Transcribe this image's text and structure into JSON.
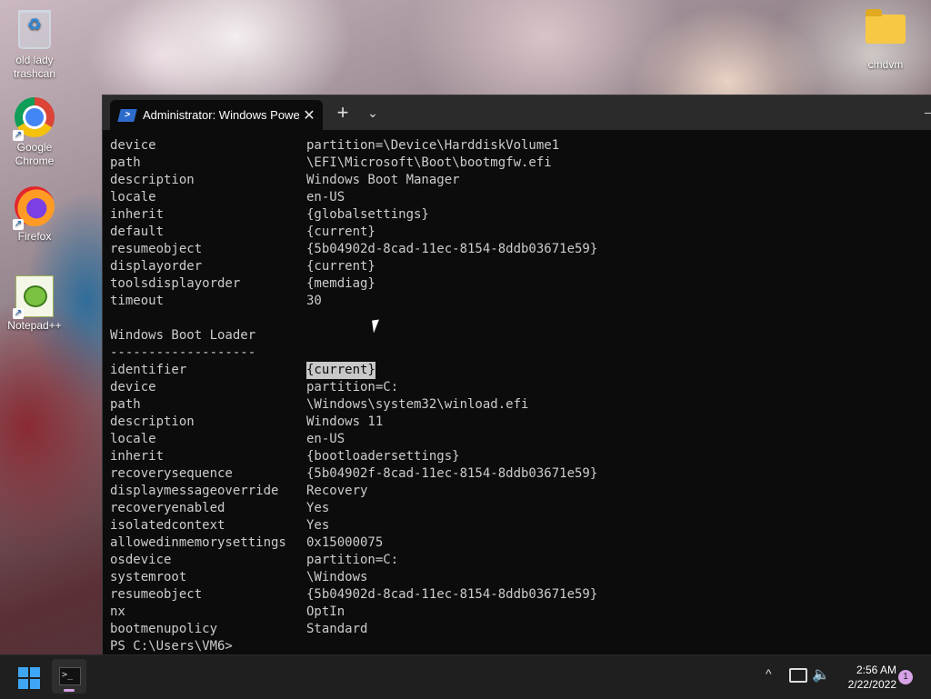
{
  "desktop": {
    "icons": [
      {
        "label": "old lady\ntrashcan"
      },
      {
        "label": "Google\nChrome"
      },
      {
        "label": "Firefox"
      },
      {
        "label": "Notepad++"
      },
      {
        "label": "cmdvm"
      }
    ]
  },
  "terminal": {
    "tab_title": "Administrator: Windows PowerS",
    "tab_close": "✕",
    "new_tab": "+",
    "dropdown": "⌄",
    "lines": [
      {
        "key": "device",
        "value": "partition=\\Device\\HarddiskVolume1"
      },
      {
        "key": "path",
        "value": "\\EFI\\Microsoft\\Boot\\bootmgfw.efi"
      },
      {
        "key": "description",
        "value": "Windows Boot Manager"
      },
      {
        "key": "locale",
        "value": "en-US"
      },
      {
        "key": "inherit",
        "value": "{globalsettings}"
      },
      {
        "key": "default",
        "value": "{current}"
      },
      {
        "key": "resumeobject",
        "value": "{5b04902d-8cad-11ec-8154-8ddb03671e59}"
      },
      {
        "key": "displayorder",
        "value": "{current}"
      },
      {
        "key": "toolsdisplayorder",
        "value": "{memdiag}"
      },
      {
        "key": "timeout",
        "value": "30"
      },
      {
        "key": "",
        "value": ""
      },
      {
        "key": "Windows Boot Loader",
        "value": ""
      },
      {
        "key": "-------------------",
        "value": ""
      },
      {
        "key": "identifier",
        "value": "{current}"
      },
      {
        "key": "device",
        "value": "partition=C:"
      },
      {
        "key": "path",
        "value": "\\Windows\\system32\\winload.efi"
      },
      {
        "key": "description",
        "value": "Windows 11"
      },
      {
        "key": "locale",
        "value": "en-US"
      },
      {
        "key": "inherit",
        "value": "{bootloadersettings}"
      },
      {
        "key": "recoverysequence",
        "value": "{5b04902f-8cad-11ec-8154-8ddb03671e59}"
      },
      {
        "key": "displaymessageoverride",
        "value": "Recovery"
      },
      {
        "key": "recoveryenabled",
        "value": "Yes"
      },
      {
        "key": "isolatedcontext",
        "value": "Yes"
      },
      {
        "key": "allowedinmemorysettings",
        "value": "0x15000075"
      },
      {
        "key": "osdevice",
        "value": "partition=C:"
      },
      {
        "key": "systemroot",
        "value": "\\Windows"
      },
      {
        "key": "resumeobject",
        "value": "{5b04902d-8cad-11ec-8154-8ddb03671e59}"
      },
      {
        "key": "nx",
        "value": "OptIn"
      },
      {
        "key": "bootmenupolicy",
        "value": "Standard"
      }
    ],
    "prompt": "PS C:\\Users\\VM6>"
  },
  "taskbar": {
    "time": "2:56 AM",
    "date": "2/22/2022",
    "notification_count": "1",
    "chevron": "^"
  },
  "colors": {
    "terminal_bg": "#0c0c0c",
    "terminal_text": "#cccccc",
    "accent": "#3ea6f5"
  }
}
